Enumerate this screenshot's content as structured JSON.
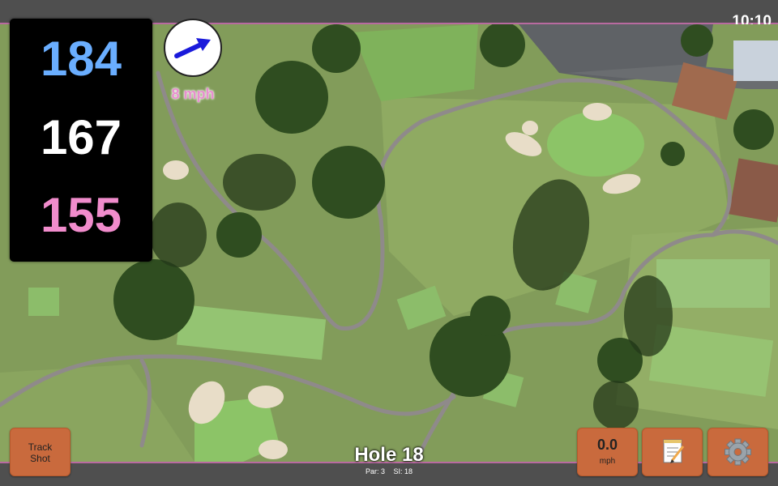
{
  "status": {
    "time": "10:10"
  },
  "yardage": {
    "back": "184",
    "middle": "167",
    "front": "155",
    "colors": {
      "back": "#6aaeff",
      "middle": "#ffffff",
      "front": "#f18ccc"
    }
  },
  "wind": {
    "speed_label": "8 mph",
    "icon": "wind-direction-arrow-icon"
  },
  "hole": {
    "title": "Hole 18",
    "par_label": "Par: 3",
    "si_label": "SI: 18"
  },
  "buttons": {
    "track_shot": "Track\nShot",
    "speed_value": "0.0",
    "speed_unit": "mph",
    "notes_icon": "notepad-icon",
    "settings_icon": "gear-icon"
  },
  "colors": {
    "button": "#c96a3d",
    "accent_border": "#b86aa0"
  }
}
